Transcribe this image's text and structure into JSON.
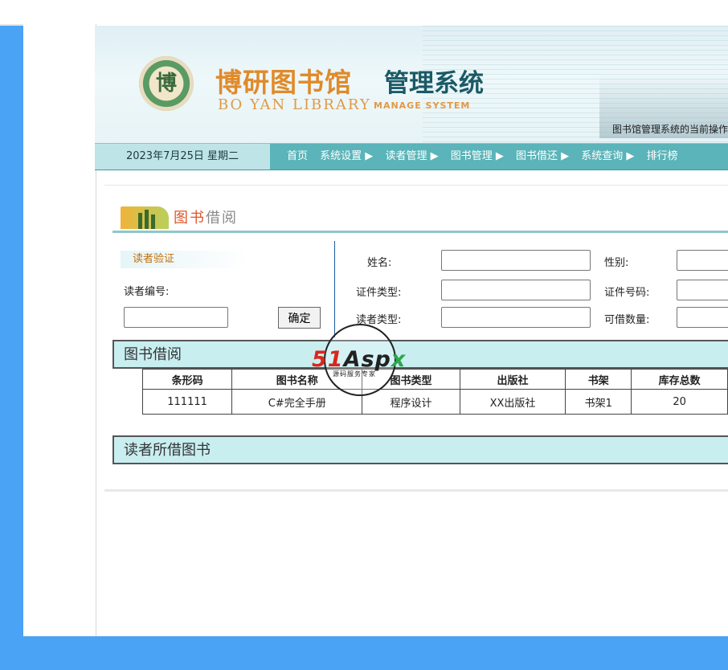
{
  "banner": {
    "logo_glyph": "博",
    "title_cn": "博研图书馆",
    "title_cn_suffix": "管理系统",
    "title_en": "BO YAN LIBRARY",
    "title_en_suffix": "MANAGE SYSTEM",
    "note": "图书馆管理系统的当前操作"
  },
  "nav": {
    "date": "2023年7月25日 星期二",
    "items": [
      "首页",
      "系统设置 ▶",
      "读者管理 ▶",
      "图书管理 ▶",
      "图书借还 ▶",
      "系统查询 ▶",
      "排行榜"
    ]
  },
  "section": {
    "title_icon_text": "图书",
    "title_rest": "借阅"
  },
  "reader_verify": {
    "tag": "读者验证",
    "id_label": "读者编号:",
    "id_value": "",
    "confirm_label": "确定"
  },
  "fields": {
    "name_label": "姓名:",
    "gender_label": "性别:",
    "idtype_label": "证件类型:",
    "idno_label": "证件号码:",
    "readertype_label": "读者类型:",
    "borrowable_label": "可借数量:"
  },
  "borrow_bar": "图书借阅",
  "table": {
    "headers": [
      "条形码",
      "图书名称",
      "图书类型",
      "出版社",
      "书架",
      "库存总数"
    ],
    "rows": [
      [
        "111111",
        "C#完全手册",
        "程序设计",
        "XX出版社",
        "书架1",
        "20"
      ]
    ]
  },
  "borrowed_bar": "读者所借图书",
  "watermark": {
    "brand_a": "51",
    "brand_b": "Asp",
    "brand_c": "x",
    "sub": "源码服务专家"
  }
}
